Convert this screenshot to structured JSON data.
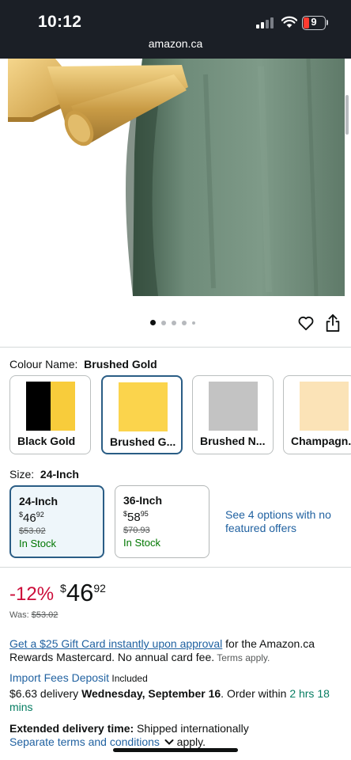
{
  "status_bar": {
    "time": "10:12",
    "battery_level": "9"
  },
  "browser": {
    "url": "amazon.ca"
  },
  "gallery": {
    "image_count": 5,
    "active_index": 0,
    "image_alt": "Brushed gold towel bar holding a green towel"
  },
  "colour": {
    "label": "Colour Name:",
    "selected": "Brushed Gold",
    "options": [
      {
        "name": "Black Gold",
        "colors": [
          "#000000",
          "#f8cc3b"
        ]
      },
      {
        "name": "Brushed G...",
        "colors": [
          "#fbd44c"
        ]
      },
      {
        "name": "Brushed N...",
        "colors": [
          "#c3c3c3"
        ]
      },
      {
        "name": "Champagn...",
        "colors": [
          "#fbe3b7"
        ]
      }
    ]
  },
  "size": {
    "label": "Size:",
    "selected": "24-Inch",
    "options": [
      {
        "name": "24-Inch",
        "currency": "$",
        "whole": "46",
        "fraction": "92",
        "was": "$53.02",
        "stock": "In Stock"
      },
      {
        "name": "36-Inch",
        "currency": "$",
        "whole": "58",
        "fraction": "95",
        "was": "$70.93",
        "stock": "In Stock"
      }
    ],
    "more_options": "See 4 options with no featured offers"
  },
  "price": {
    "discount": "-12%",
    "currency": "$",
    "whole": "46",
    "fraction": "92",
    "was_label": "Was:",
    "was_value": "$53.02"
  },
  "gift_card": {
    "link": "Get a $25 Gift Card instantly upon approval",
    "text": " for the Amazon.ca Rewards Mastercard. No annual card fee.",
    "terms": " Terms apply."
  },
  "import_fees": {
    "link": "Import Fees Deposit",
    "text": " Included"
  },
  "delivery": {
    "prefix": "$6.63 delivery ",
    "date": "Wednesday, September 16",
    "order_within": ". Order within ",
    "countdown": "2 hrs 18 mins"
  },
  "extended": {
    "label": "Extended delivery time:",
    "text": " Shipped internationally",
    "terms_link": "Separate terms and conditions",
    "terms_suffix": " apply."
  },
  "colors": {
    "link": "#2162a1",
    "discount": "#cc0c39",
    "in_stock": "#007600",
    "selected_border": "#2a5d85",
    "countdown": "#067d62"
  }
}
